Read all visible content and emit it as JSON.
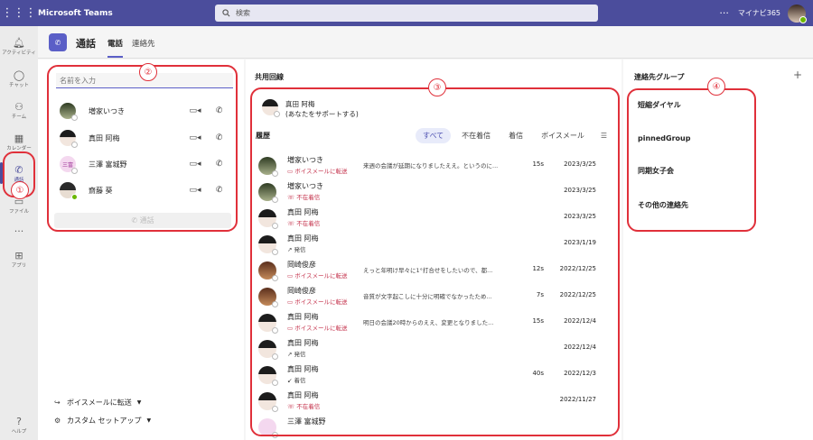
{
  "app_title": "Microsoft Teams",
  "search": {
    "placeholder": "検索"
  },
  "top_right": {
    "more": "···",
    "tenant": "マイナビ365"
  },
  "rail": [
    {
      "label": "アクティビティ",
      "icon": "bell-icon"
    },
    {
      "label": "チャット",
      "icon": "chat-icon"
    },
    {
      "label": "チーム",
      "icon": "teams-icon"
    },
    {
      "label": "カレンダー",
      "icon": "calendar-icon"
    },
    {
      "label": "通話",
      "icon": "phone-icon"
    },
    {
      "label": "ファイル",
      "icon": "file-icon"
    },
    {
      "label": "···",
      "icon": "more-icon"
    },
    {
      "label": "アプリ",
      "icon": "apps-icon"
    },
    {
      "label": "ヘルプ",
      "icon": "help-icon"
    }
  ],
  "header": {
    "title": "通話",
    "tabs": [
      "電話",
      "連絡先"
    ],
    "active_tab": "電話"
  },
  "dialer": {
    "placeholder": "名前を入力",
    "contacts": [
      "増家いつき",
      "真田 阿梅",
      "三澤 富城野",
      "齋藤 葵"
    ],
    "call_button": "通話",
    "links": [
      "ボイスメールに転送",
      "カスタム セットアップ"
    ]
  },
  "shared_line": {
    "label": "共用回線",
    "name": "真田 阿梅",
    "sub": "(あなたをサポートする)"
  },
  "history": {
    "label": "履歴",
    "filters": [
      "すべて",
      "不在着信",
      "着信",
      "ボイスメール"
    ],
    "active_filter": "すべて",
    "rows": [
      {
        "name": "増家いつき",
        "status": "ボイスメールに転送",
        "red": true,
        "preview": "来週の会議が延期になりましたええ。というのに...",
        "duration": "15s",
        "date": "2023/3/25"
      },
      {
        "name": "増家いつき",
        "status": "不在着信",
        "red": true,
        "preview": "",
        "duration": "",
        "date": "2023/3/25"
      },
      {
        "name": "真田 阿梅",
        "status": "不在着信",
        "red": true,
        "preview": "",
        "duration": "",
        "date": "2023/3/25"
      },
      {
        "name": "真田 阿梅",
        "status": "発信",
        "red": false,
        "preview": "",
        "duration": "",
        "date": "2023/1/19"
      },
      {
        "name": "岡崎俊彦",
        "status": "ボイスメールに転送",
        "red": true,
        "preview": "えっと年明け早々に1°打合せをしたいので、都...",
        "duration": "12s",
        "date": "2022/12/25"
      },
      {
        "name": "岡崎俊彦",
        "status": "ボイスメールに転送",
        "red": true,
        "preview": "音質が文字起こしに十分に明確でなかったため...",
        "duration": "7s",
        "date": "2022/12/25"
      },
      {
        "name": "真田 阿梅",
        "status": "ボイスメールに転送",
        "red": true,
        "preview": "明日の会議20時からのええ、変更となりました...",
        "duration": "15s",
        "date": "2022/12/4"
      },
      {
        "name": "真田 阿梅",
        "status": "発信",
        "red": false,
        "preview": "",
        "duration": "",
        "date": "2022/12/4"
      },
      {
        "name": "真田 阿梅",
        "status": "着信",
        "red": false,
        "preview": "",
        "duration": "40s",
        "date": "2022/12/3"
      },
      {
        "name": "真田 阿梅",
        "status": "不在着信",
        "red": true,
        "preview": "",
        "duration": "",
        "date": "2022/11/27"
      },
      {
        "name": "三澤 富城野",
        "status": "",
        "red": false,
        "preview": "",
        "duration": "",
        "date": ""
      }
    ]
  },
  "groups": {
    "label": "連絡先グループ",
    "add": "+",
    "items": [
      "短縮ダイヤル",
      "pinnedGroup",
      "同期女子会",
      "その他の連絡先"
    ]
  },
  "annotations": [
    "①",
    "②",
    "③",
    "④"
  ],
  "colors": {
    "brand": "#4b4d9c",
    "accent": "#5b5fc7",
    "missed": "#c4314b",
    "annotation": "#e0303a"
  }
}
